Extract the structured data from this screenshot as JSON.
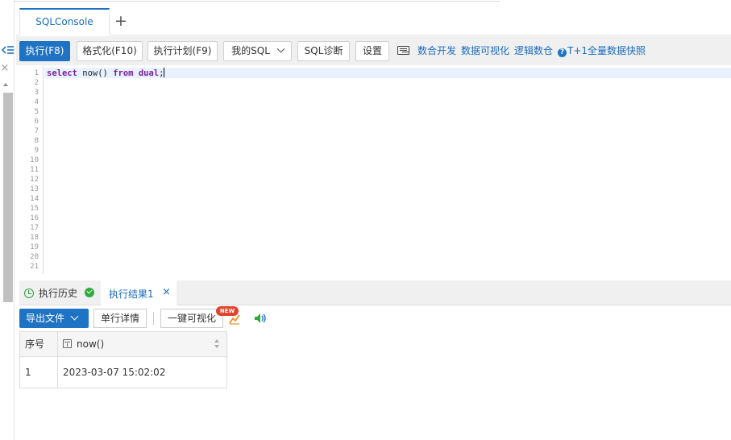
{
  "tabs": [
    {
      "label": "SQLConsole",
      "active": true
    }
  ],
  "tab_add": "+",
  "toolbar": {
    "execute": "执行(F8)",
    "format": "格式化(F10)",
    "exec_plan": "执行计划(F9)",
    "my_sql": "我的SQL",
    "sql_diagnose": "SQL诊断",
    "settings": "设置",
    "data_dev": "数合开发",
    "data_visualize": "数据可视化",
    "logic_warehouse": "逻辑数仓",
    "help_mark": "?",
    "snapshot": "T+1全量数据快照"
  },
  "editor": {
    "line_numbers": [
      "1",
      "2",
      "3",
      "4",
      "5",
      "6",
      "7",
      "8",
      "9",
      "10",
      "11",
      "12",
      "13",
      "14",
      "15",
      "16",
      "17",
      "18",
      "19",
      "20",
      "21"
    ],
    "code": {
      "kw_select": "select",
      "fn": " now() ",
      "kw_from": "from",
      "space": " ",
      "kw_table": "dual",
      "semicolon": ";"
    }
  },
  "result_tabs": {
    "history": "执行历史",
    "result": "执行结果1",
    "close": "×"
  },
  "result_toolbar": {
    "export": "导出文件",
    "row_detail": "单行详情",
    "visualize": "一键可视化",
    "new_badge": "NEW"
  },
  "table": {
    "columns": [
      "序号",
      "now()"
    ],
    "rows": [
      [
        "1",
        "2023-03-07 15:02:02"
      ]
    ]
  },
  "colors": {
    "accent": "#1f73c4",
    "link": "#1a6bbf",
    "keyword": "#7a1f9e",
    "success": "#2eab3f",
    "badge": "#e2452f"
  }
}
